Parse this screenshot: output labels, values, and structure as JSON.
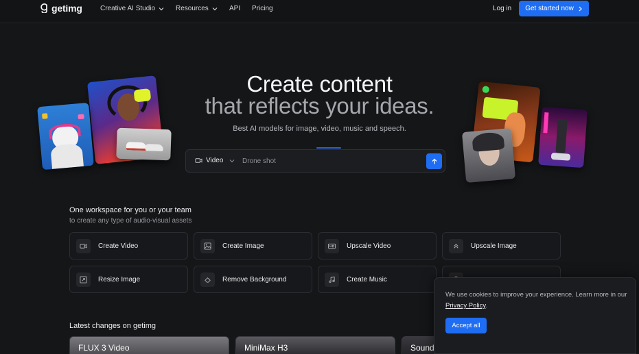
{
  "nav": {
    "logo_text": "getimg",
    "items": [
      {
        "label": "Creative AI Studio",
        "has_dropdown": true
      },
      {
        "label": "Resources",
        "has_dropdown": true
      },
      {
        "label": "API",
        "has_dropdown": false
      },
      {
        "label": "Pricing",
        "has_dropdown": false
      }
    ],
    "login_label": "Log in",
    "cta_label": "Get started now"
  },
  "hero": {
    "title_line1": "Create content",
    "title_line2": "that reflects your ideas.",
    "subtitle": "Best AI models for image, video, music and speech.",
    "prompt": {
      "mode_label": "Video",
      "placeholder": "Drone shot",
      "value": ""
    }
  },
  "workspace": {
    "title": "One workspace for you or your team",
    "subtitle": "to create any type of audio-visual assets",
    "tiles": [
      {
        "label": "Create Video",
        "icon": "video-camera-icon"
      },
      {
        "label": "Create Image",
        "icon": "image-icon"
      },
      {
        "label": "Upscale Video",
        "icon": "hd-icon"
      },
      {
        "label": "Upscale Image",
        "icon": "chevrons-up-icon"
      },
      {
        "label": "Resize Image",
        "icon": "resize-icon"
      },
      {
        "label": "Remove Background",
        "icon": "eraser-icon"
      },
      {
        "label": "Create Music",
        "icon": "music-note-icon"
      },
      {
        "label": "",
        "icon": "microphone-icon"
      }
    ]
  },
  "latest": {
    "title": "Latest changes on getimg",
    "cards": [
      {
        "label": "FLUX 3 Video"
      },
      {
        "label": "MiniMax H3"
      },
      {
        "label": "Sound Effects"
      }
    ]
  },
  "cookie": {
    "text": "We use cookies to improve your experience. Learn more in our",
    "link_label": "Privacy Policy",
    "suffix": ".",
    "accept_label": "Accept all"
  },
  "colors": {
    "background": "#151618",
    "accent": "#1f6df2",
    "muted_text": "#a6a7ac"
  }
}
